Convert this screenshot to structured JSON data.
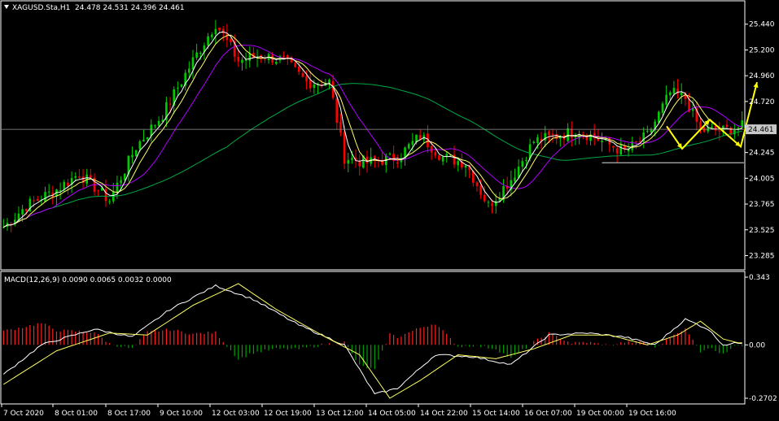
{
  "header": {
    "symbol_title": "XAGUSD.Sta,H1",
    "ohlc": "24.478 24.531 24.396 24.461"
  },
  "macd": {
    "title": "MACD(12,26,9) 0.0090 0.0065 0.0032 0.0000"
  },
  "colors": {
    "background": "#000000",
    "frame": "#ffffff",
    "bull": "#00cc00",
    "bear": "#ff0000",
    "ma_fast": "#ffffff",
    "ma_mid": "#ffff66",
    "ma_slow": "#b000ff",
    "ma_long": "#00aa44",
    "arrow": "#ffff00",
    "hist_pos": "#ff2020",
    "hist_neg": "#00a000",
    "macd_line": "#ffffff",
    "signal_line": "#ffff66"
  },
  "chart_data": [
    {
      "type": "candlestick",
      "title": "XAGUSD.Sta,H1",
      "ylim": [
        23.16,
        25.65
      ],
      "y_ticks": [
        "25.440",
        "25.200",
        "24.960",
        "24.720",
        "24.245",
        "24.005",
        "23.765",
        "23.525",
        "23.285"
      ],
      "current_price_label": "24.461",
      "x_ticks": [
        "7 Oct 2020",
        "8 Oct 01:00",
        "8 Oct 17:00",
        "9 Oct 10:00",
        "12 Oct 03:00",
        "12 Oct 19:00",
        "13 Oct 12:00",
        "14 Oct 05:00",
        "14 Oct 22:00",
        "15 Oct 14:00",
        "16 Oct 07:00",
        "19 Oct 00:00",
        "19 Oct 16:00"
      ],
      "series": [
        {
          "name": "MA fast",
          "values_key": "close_smoothing"
        }
      ],
      "anchors_time_price": [
        [
          0,
          23.55
        ],
        [
          6,
          23.75
        ],
        [
          14,
          23.9
        ],
        [
          20,
          24.05
        ],
        [
          28,
          23.8
        ],
        [
          35,
          24.3
        ],
        [
          42,
          24.6
        ],
        [
          50,
          25.1
        ],
        [
          56,
          25.45
        ],
        [
          62,
          25.1
        ],
        [
          68,
          25.15
        ],
        [
          74,
          25.1
        ],
        [
          80,
          24.9
        ],
        [
          86,
          24.9
        ],
        [
          90,
          24.2
        ],
        [
          96,
          24.15
        ],
        [
          104,
          24.2
        ],
        [
          110,
          24.4
        ],
        [
          116,
          24.2
        ],
        [
          122,
          24.15
        ],
        [
          128,
          23.75
        ],
        [
          134,
          24.0
        ],
        [
          140,
          24.35
        ],
        [
          146,
          24.4
        ],
        [
          152,
          24.45
        ],
        [
          158,
          24.35
        ],
        [
          164,
          24.25
        ],
        [
          170,
          24.4
        ],
        [
          176,
          24.8
        ],
        [
          180,
          24.75
        ],
        [
          184,
          24.45
        ],
        [
          190,
          24.45
        ],
        [
          194,
          24.48
        ]
      ],
      "forecast_path": [
        [
          24.49
        ],
        [
          24.28
        ],
        [
          24.55
        ],
        [
          24.3
        ],
        [
          24.9
        ]
      ],
      "support_level": 24.15
    },
    {
      "type": "macd",
      "title": "MACD(12,26,9)",
      "ylim": [
        -0.2702,
        0.343
      ],
      "y_ticks": [
        "0.343",
        "0.00",
        "-0.2702"
      ],
      "macd_anchors": [
        [
          0,
          -0.15
        ],
        [
          10,
          0.0
        ],
        [
          24,
          0.08
        ],
        [
          34,
          0.04
        ],
        [
          44,
          0.18
        ],
        [
          56,
          0.3
        ],
        [
          66,
          0.23
        ],
        [
          78,
          0.1
        ],
        [
          90,
          0.0
        ],
        [
          98,
          -0.25
        ],
        [
          104,
          -0.22
        ],
        [
          114,
          -0.05
        ],
        [
          124,
          -0.06
        ],
        [
          134,
          -0.1
        ],
        [
          144,
          0.05
        ],
        [
          154,
          0.06
        ],
        [
          164,
          0.04
        ],
        [
          172,
          0.0
        ],
        [
          180,
          0.13
        ],
        [
          186,
          0.08
        ],
        [
          190,
          0.0
        ],
        [
          194,
          0.01
        ]
      ],
      "signal_anchors": [
        [
          0,
          -0.2
        ],
        [
          14,
          -0.03
        ],
        [
          28,
          0.06
        ],
        [
          38,
          0.05
        ],
        [
          50,
          0.2
        ],
        [
          62,
          0.31
        ],
        [
          72,
          0.18
        ],
        [
          84,
          0.05
        ],
        [
          94,
          -0.05
        ],
        [
          102,
          -0.27
        ],
        [
          110,
          -0.18
        ],
        [
          120,
          -0.05
        ],
        [
          130,
          -0.07
        ],
        [
          140,
          -0.02
        ],
        [
          150,
          0.05
        ],
        [
          160,
          0.05
        ],
        [
          170,
          0.0
        ],
        [
          178,
          0.05
        ],
        [
          184,
          0.12
        ],
        [
          190,
          0.03
        ],
        [
          194,
          0.01
        ]
      ]
    }
  ]
}
